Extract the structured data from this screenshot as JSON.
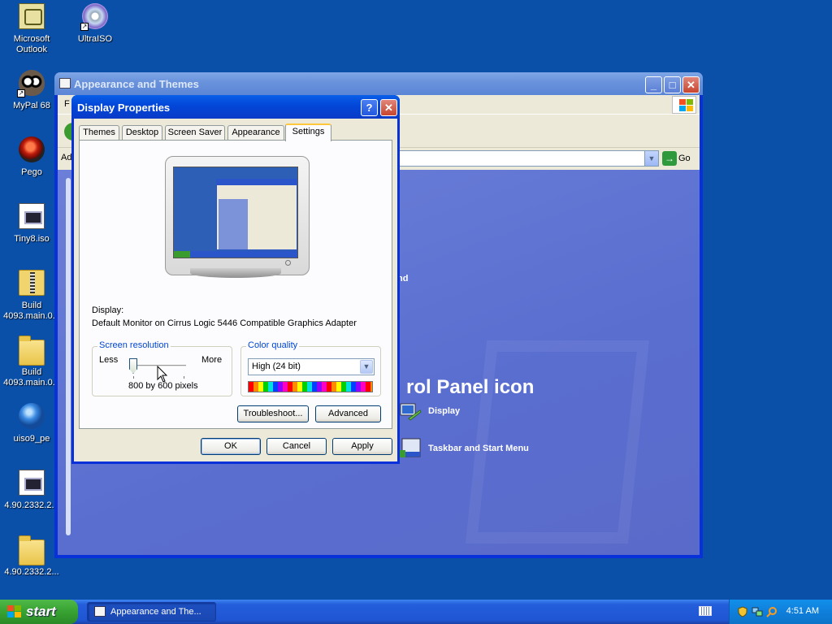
{
  "desktop": {
    "icons": [
      {
        "label": "Microsoft Outlook",
        "icon": "outlook-icon"
      },
      {
        "label": "UltraISO",
        "icon": "cd-icon"
      },
      {
        "label": "MyPal 68",
        "icon": "raccoon-icon"
      },
      {
        "label": "Pego",
        "icon": "red-orb-icon"
      },
      {
        "label": "Tiny8.iso",
        "icon": "iso-file-icon"
      },
      {
        "label": "Build 4093.main.0...",
        "icon": "zip-folder-icon"
      },
      {
        "label": "Build 4093.main.0...",
        "icon": "folder-icon"
      },
      {
        "label": "uiso9_pe",
        "icon": "globe-icon"
      },
      {
        "label": "4.90.2332.2...",
        "icon": "iso-file-icon"
      },
      {
        "label": "4.90.2332.2...",
        "icon": "folder-icon"
      }
    ]
  },
  "explorer": {
    "title": "Appearance and Themes",
    "menu_fragment": "F",
    "address_fragment": "Ad",
    "go_label": "Go",
    "text_fragments": {
      "frag1": "e",
      "frag2": "nd"
    },
    "heading": "rol Panel icon",
    "tasks": [
      {
        "label": "Display",
        "icon": "display-icon"
      },
      {
        "label": "Taskbar and Start Menu",
        "icon": "taskbar-icon"
      }
    ]
  },
  "dialog": {
    "title": "Display Properties",
    "help": "?",
    "close": "✕",
    "tabs": [
      "Themes",
      "Desktop",
      "Screen Saver",
      "Appearance",
      "Settings"
    ],
    "active_tab": "Settings",
    "display_label": "Display:",
    "display_value": "Default Monitor on Cirrus Logic 5446 Compatible Graphics Adapter",
    "resolution": {
      "caption": "Screen resolution",
      "less": "Less",
      "more": "More",
      "value": "800 by 600 pixels",
      "slider_position": 0
    },
    "color": {
      "caption": "Color quality",
      "selected": "High (24 bit)"
    },
    "buttons": {
      "troubleshoot": "Troubleshoot...",
      "advanced": "Advanced",
      "ok": "OK",
      "cancel": "Cancel",
      "apply": "Apply"
    }
  },
  "taskbar": {
    "start": "start",
    "item": "Appearance and The...",
    "clock": "4:51 AM"
  },
  "colors": {
    "desktop": "#0a4fa8",
    "title_active": "#0246d8",
    "title_inactive": "#7fa7e6",
    "start_green": "#37a231"
  }
}
